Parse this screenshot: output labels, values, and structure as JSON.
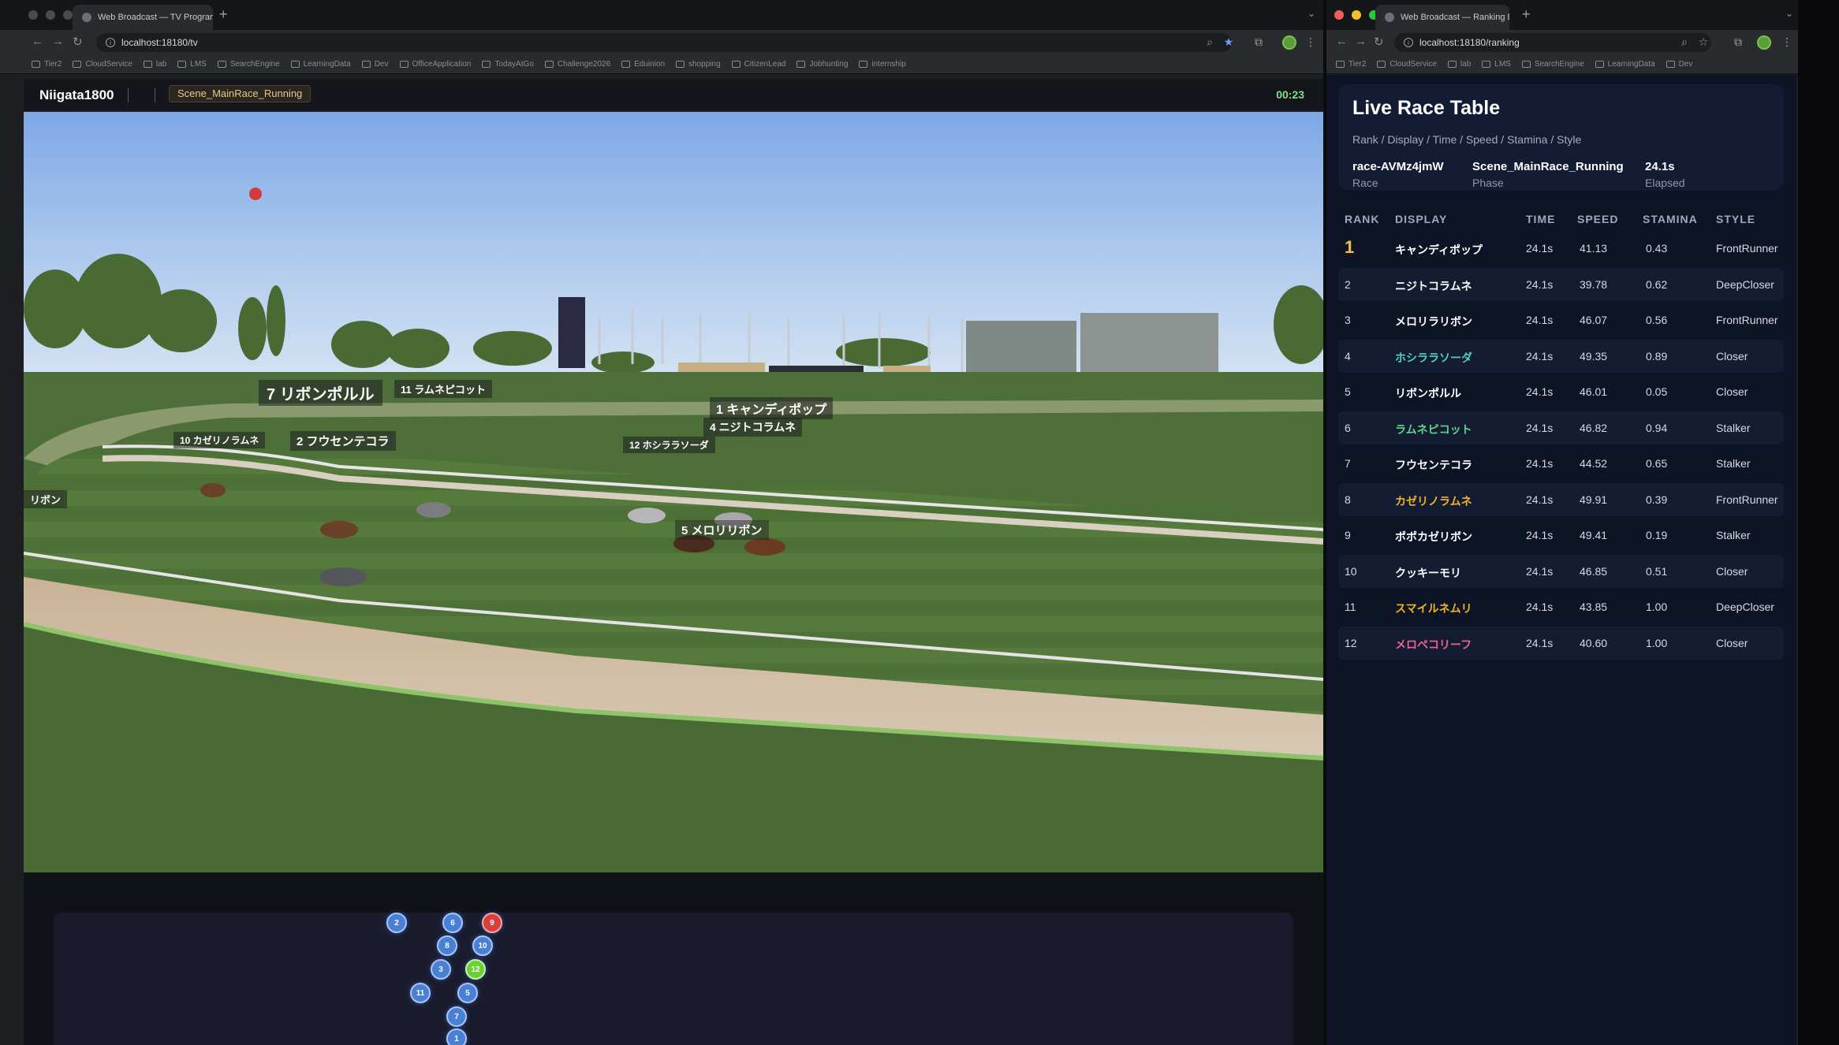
{
  "left_window": {
    "tab_title": "Web Broadcast — TV Program",
    "url": "localhost:18180/tv",
    "bookmarks": [
      "Tier2",
      "CloudService",
      "lab",
      "LMS",
      "SearchEngine",
      "LearningData",
      "Dev",
      "OfficeApplication",
      "TodayAtGo",
      "Challenge2026",
      "Eduinion",
      "shopping",
      "CitizenLead",
      "Jobhunting",
      "internship"
    ]
  },
  "broadcast": {
    "venue": "Niigata1800",
    "scene": "Scene_MainRace_Running",
    "timer": "00:23"
  },
  "overlays": [
    {
      "text": "7 リボンポルル"
    },
    {
      "text": "11 ラムネピコット"
    },
    {
      "text": "1 キャンディポップ"
    },
    {
      "text": "4 ニジトコラムネ"
    },
    {
      "text": "10 カゼリノラムネ"
    },
    {
      "text": "2 フウセンテコラ"
    },
    {
      "text": "12 ホシララソーダ"
    },
    {
      "text": "リボン"
    },
    {
      "text": "5 メロリリボン"
    }
  ],
  "minimap_markers": [
    {
      "label": "2",
      "color": "blue"
    },
    {
      "label": "6",
      "color": "blue"
    },
    {
      "label": "9",
      "color": "red"
    },
    {
      "label": "8",
      "color": "blue"
    },
    {
      "label": "10",
      "color": "blue"
    },
    {
      "label": "3",
      "color": "blue"
    },
    {
      "label": "12",
      "color": "green"
    },
    {
      "label": "11",
      "color": "blue"
    },
    {
      "label": "5",
      "color": "blue"
    },
    {
      "label": "7",
      "color": "blue"
    },
    {
      "label": "1",
      "color": "blue"
    }
  ],
  "right_window": {
    "tab_title": "Web Broadcast — Ranking B",
    "url": "localhost:18180/ranking",
    "bookmarks": [
      "Tier2",
      "CloudService",
      "lab",
      "LMS",
      "SearchEngine",
      "LearningData",
      "Dev"
    ]
  },
  "ranking": {
    "title": "Live Race Table",
    "subtitle": "Rank / Display / Time / Speed / Stamina / Style",
    "race_id": "race-AVMz4jmW",
    "race_label": "Race",
    "phase": "Scene_MainRace_Running",
    "phase_label": "Phase",
    "elapsed": "24.1s",
    "elapsed_label": "Elapsed",
    "columns": [
      "RANK",
      "DISPLAY",
      "TIME",
      "SPEED",
      "STAMINA",
      "STYLE"
    ],
    "rows": [
      {
        "rank": "1",
        "display": "キャンディポップ",
        "time": "24.1s",
        "speed": "41.13",
        "stamina": "0.43",
        "style": "FrontRunner",
        "color": "#ffffff"
      },
      {
        "rank": "2",
        "display": "ニジトコラムネ",
        "time": "24.1s",
        "speed": "39.78",
        "stamina": "0.62",
        "style": "DeepCloser",
        "color": "#ffffff"
      },
      {
        "rank": "3",
        "display": "メロリラリボン",
        "time": "24.1s",
        "speed": "46.07",
        "stamina": "0.56",
        "style": "FrontRunner",
        "color": "#ffffff"
      },
      {
        "rank": "4",
        "display": "ホシララソーダ",
        "time": "24.1s",
        "speed": "49.35",
        "stamina": "0.89",
        "style": "Closer",
        "color": "#4fd1c5"
      },
      {
        "rank": "5",
        "display": "リボンポルル",
        "time": "24.1s",
        "speed": "46.01",
        "stamina": "0.05",
        "style": "Closer",
        "color": "#ffffff"
      },
      {
        "rank": "6",
        "display": "ラムネピコット",
        "time": "24.1s",
        "speed": "46.82",
        "stamina": "0.94",
        "style": "Stalker",
        "color": "#5fd38b"
      },
      {
        "rank": "7",
        "display": "フウセンテコラ",
        "time": "24.1s",
        "speed": "44.52",
        "stamina": "0.65",
        "style": "Stalker",
        "color": "#ffffff"
      },
      {
        "rank": "8",
        "display": "カゼリノラムネ",
        "time": "24.1s",
        "speed": "49.91",
        "stamina": "0.39",
        "style": "FrontRunner",
        "color": "#f0b429"
      },
      {
        "rank": "9",
        "display": "ポポカゼリボン",
        "time": "24.1s",
        "speed": "49.41",
        "stamina": "0.19",
        "style": "Stalker",
        "color": "#ffffff"
      },
      {
        "rank": "10",
        "display": "クッキーモリ",
        "time": "24.1s",
        "speed": "46.85",
        "stamina": "0.51",
        "style": "Closer",
        "color": "#ffffff"
      },
      {
        "rank": "11",
        "display": "スマイルネムリ",
        "time": "24.1s",
        "speed": "43.85",
        "stamina": "1.00",
        "style": "DeepCloser",
        "color": "#f0b429"
      },
      {
        "rank": "12",
        "display": "メロペコリーフ",
        "time": "24.1s",
        "speed": "40.60",
        "stamina": "1.00",
        "style": "Closer",
        "color": "#f06292"
      }
    ]
  }
}
